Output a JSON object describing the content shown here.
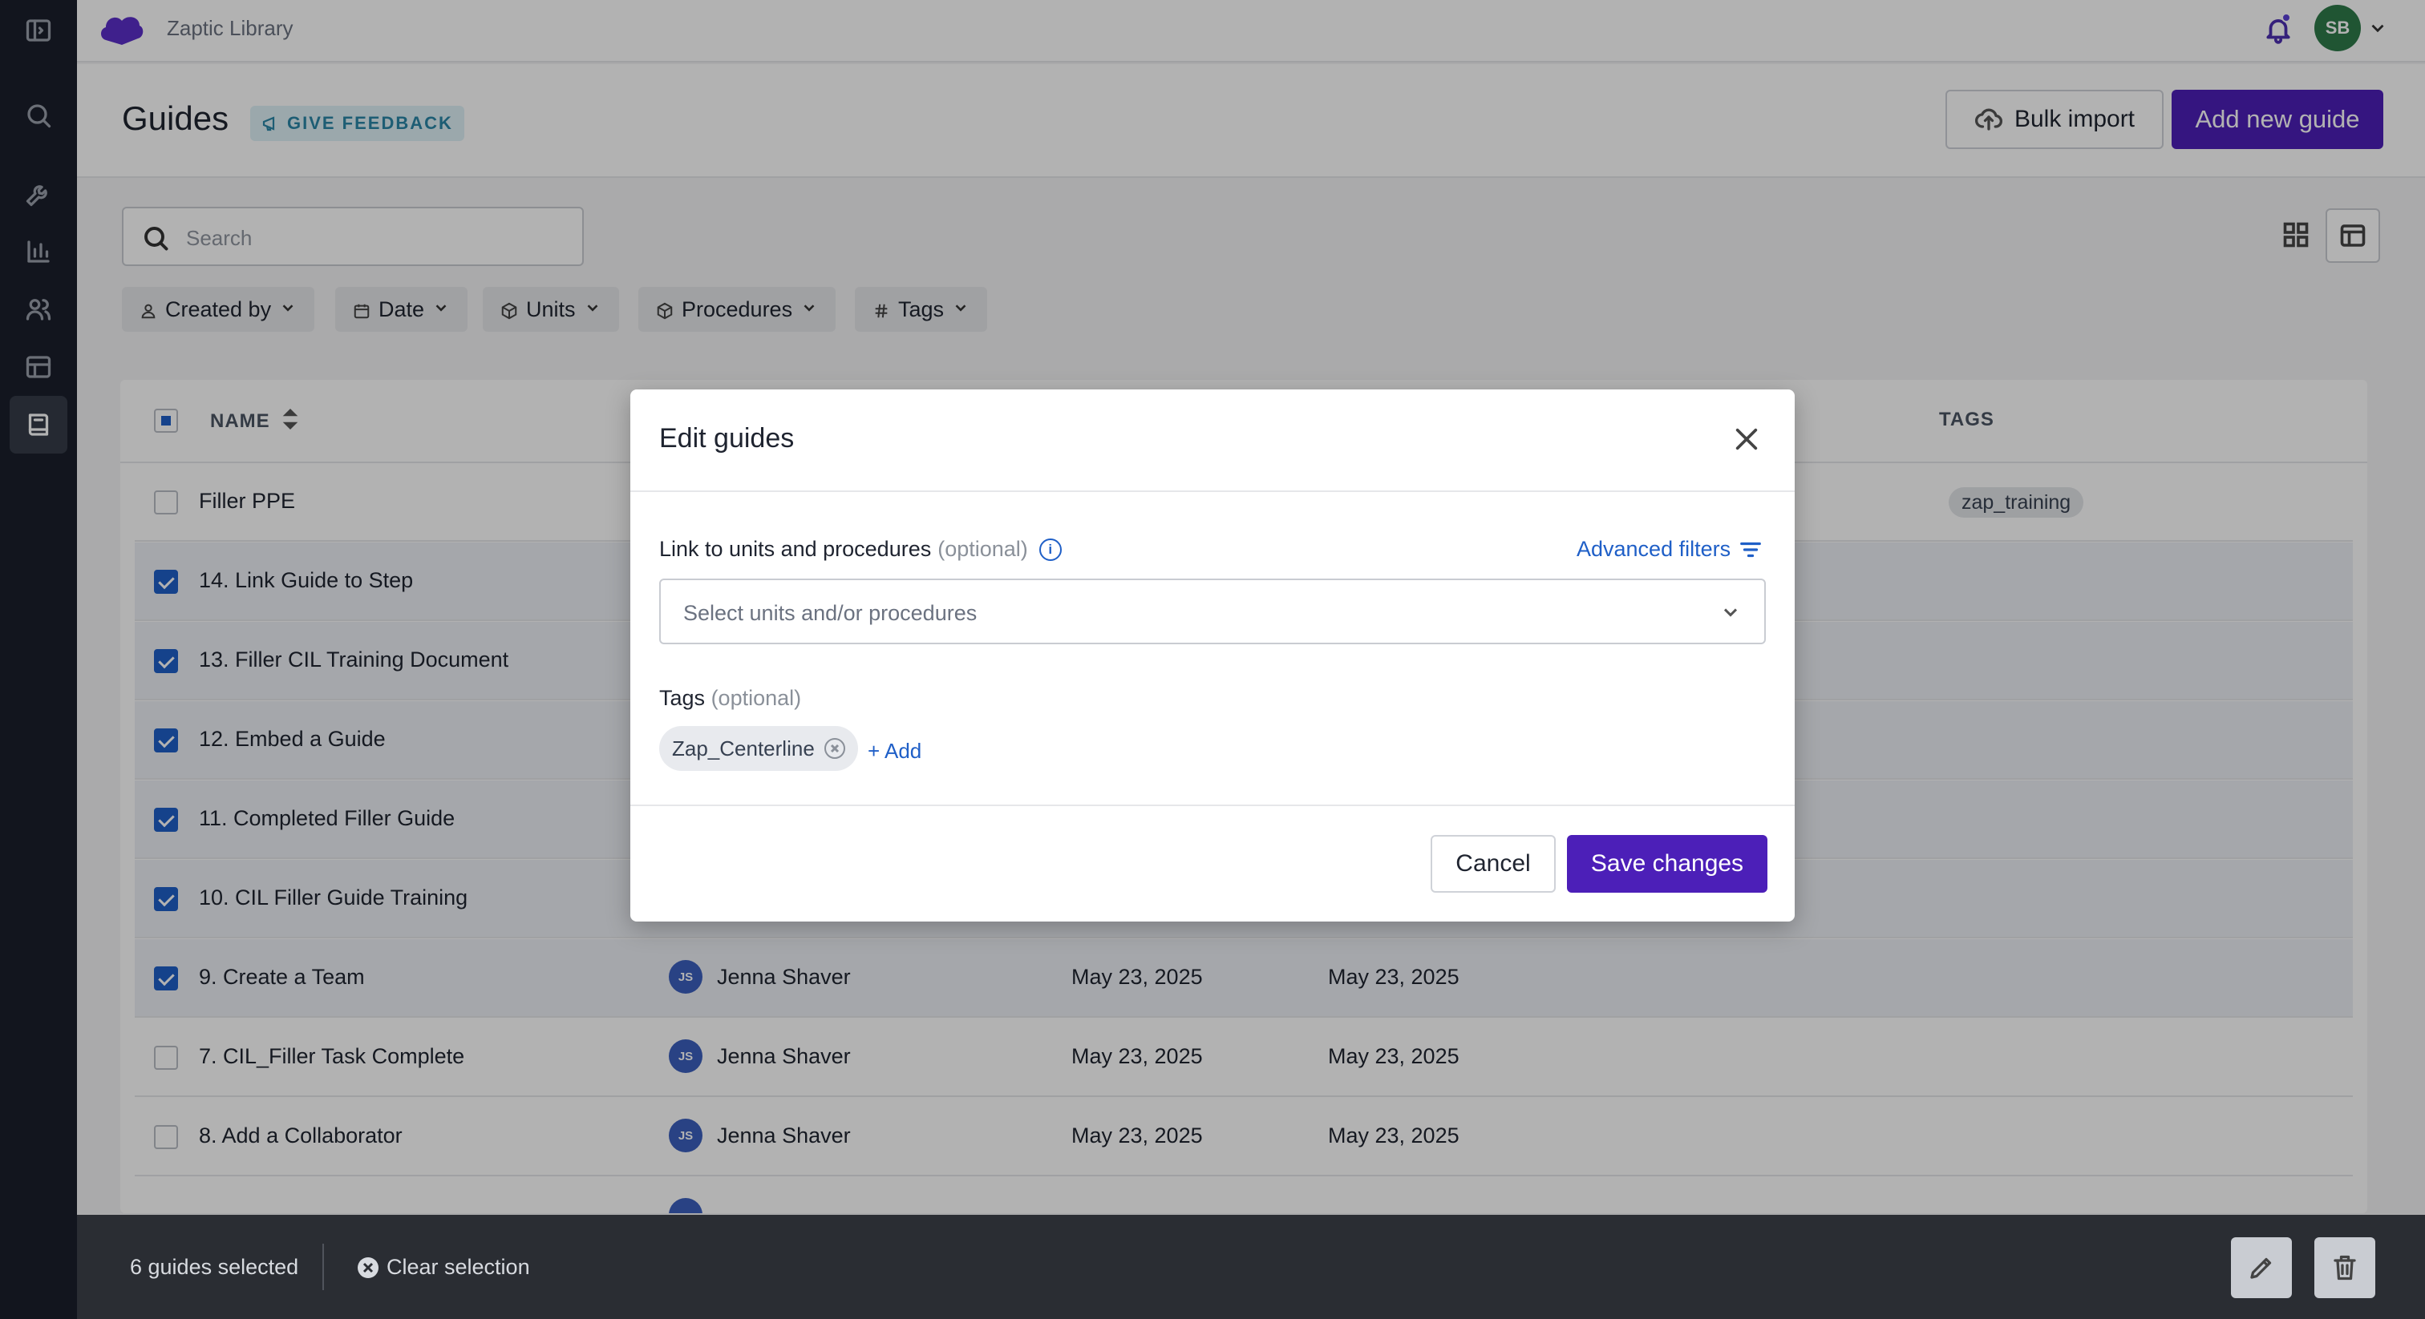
{
  "app": {
    "title": "Zaptic Library"
  },
  "user": {
    "initials": "SB"
  },
  "header": {
    "title": "Guides",
    "feedback_label": "GIVE FEEDBACK",
    "bulk_import_label": "Bulk import",
    "add_guide_label": "Add new guide"
  },
  "search": {
    "placeholder": "Search"
  },
  "filters": [
    {
      "label": "Created by",
      "icon": "user-icon"
    },
    {
      "label": "Date",
      "icon": "calendar-icon"
    },
    {
      "label": "Units",
      "icon": "cube-icon"
    },
    {
      "label": "Procedures",
      "icon": "box-icon"
    },
    {
      "label": "Tags",
      "icon": "hash-icon"
    }
  ],
  "table": {
    "columns": {
      "name": "NAME",
      "tags": "TAGS"
    },
    "rows": [
      {
        "name": "Filler PPE",
        "selected": false,
        "tag": "zap_training"
      },
      {
        "name": "14. Link Guide to Step",
        "selected": true
      },
      {
        "name": "13. Filler CIL Training Document",
        "selected": true
      },
      {
        "name": "12. Embed a Guide",
        "selected": true
      },
      {
        "name": "11. Completed Filler Guide",
        "selected": true
      },
      {
        "name": "10. CIL Filler Guide Training",
        "selected": true
      },
      {
        "name": "9. Create a Team",
        "selected": true,
        "creator_initials": "JS",
        "creator": "Jenna Shaver",
        "created": "May 23, 2025",
        "updated": "May 23, 2025"
      },
      {
        "name": "7. CIL_Filler Task Complete",
        "selected": false,
        "creator_initials": "JS",
        "creator": "Jenna Shaver",
        "created": "May 23, 2025",
        "updated": "May 23, 2025"
      },
      {
        "name": "8. Add a Collaborator",
        "selected": false,
        "creator_initials": "JS",
        "creator": "Jenna Shaver",
        "created": "May 23, 2025",
        "updated": "May 23, 2025"
      }
    ]
  },
  "bottom_bar": {
    "selected_text": "6 guides selected",
    "clear_label": "Clear selection"
  },
  "modal": {
    "title": "Edit guides",
    "link_label": "Link to units and procedures",
    "optional_text": "(optional)",
    "advanced_filters_label": "Advanced filters",
    "select_placeholder": "Select units and/or procedures",
    "tags_label": "Tags",
    "tags": [
      "Zap_Centerline"
    ],
    "add_tag_label": "+ Add",
    "cancel_label": "Cancel",
    "save_label": "Save changes"
  },
  "colors": {
    "primary": "#4c1fb8",
    "link": "#1f5fc7",
    "sidebar": "#1a1f2b"
  }
}
